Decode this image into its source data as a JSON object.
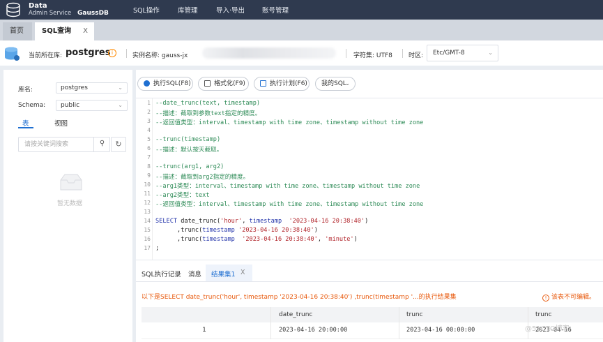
{
  "topbar": {
    "brand_line1": "Data",
    "brand_line2": "Admin Service",
    "brand_product": "GaussDB",
    "nav": [
      "SQL操作",
      "库管理",
      "导入·导出",
      "账号管理"
    ]
  },
  "tabs": {
    "home": "首页",
    "sql": "SQL查询",
    "close": "X"
  },
  "info": {
    "current_db_label": "当前所在库:",
    "current_db": "postgres",
    "instance_label": "实例名称: gauss-jx",
    "charset_label": "字符集: UTF8",
    "timezone_label": "时区:",
    "timezone_value": "Etc/GMT-8"
  },
  "left": {
    "db_label": "库名:",
    "db_value": "postgres",
    "schema_label": "Schema:",
    "schema_value": "public",
    "tab_table": "表",
    "tab_view": "视图",
    "search_placeholder": "请按关键词搜索",
    "empty_text": "暂无数据"
  },
  "toolbar": {
    "run": "执行SQL(F8)",
    "format": "格式化(F9)",
    "plan": "执行计划(F6)",
    "mysql": "我的SQL"
  },
  "editor": {
    "lines": [
      "--date_trunc(text, timestamp)",
      "--描述：截取到参数text指定的精度。",
      "--返回值类型：interval、timestamp with time zone、timestamp without time zone",
      "",
      "--trunc(timestamp)",
      "--描述：默认按天截取。",
      "",
      "--trunc(arg1, arg2)",
      "--描述：截取到arg2指定的精度。",
      "--arg1类型：interval、timestamp with time zone、timestamp without time zone",
      "--arg2类型：text",
      "--返回值类型：interval、timestamp with time zone、timestamp without time zone",
      "",
      "SELECT date_trunc('hour', timestamp  '2023-04-16 20:38:40')",
      "      ,trunc(timestamp '2023-04-16 20:38:40')",
      "      ,trunc(timestamp  '2023-04-16 20:38:40', 'minute')",
      ";"
    ]
  },
  "results": {
    "tab_history": "SQL执行记录",
    "tab_message": "消息",
    "tab_result": "结果集1",
    "message": "以下是SELECT date_trunc('hour', timestamp '2023-04-16 20:38:40') ,trunc(timestamp '...的执行结果集",
    "readonly_icon": "!",
    "readonly": "该表不可编辑。",
    "columns": [
      "",
      "date_trunc",
      "trunc",
      "trunc"
    ],
    "rows": [
      [
        "1",
        "2023-04-16 20:00:00",
        "2023-04-16 00:00:00",
        "2023-04-16 20:38:00"
      ]
    ],
    "watermark": "@51CTO博客"
  }
}
